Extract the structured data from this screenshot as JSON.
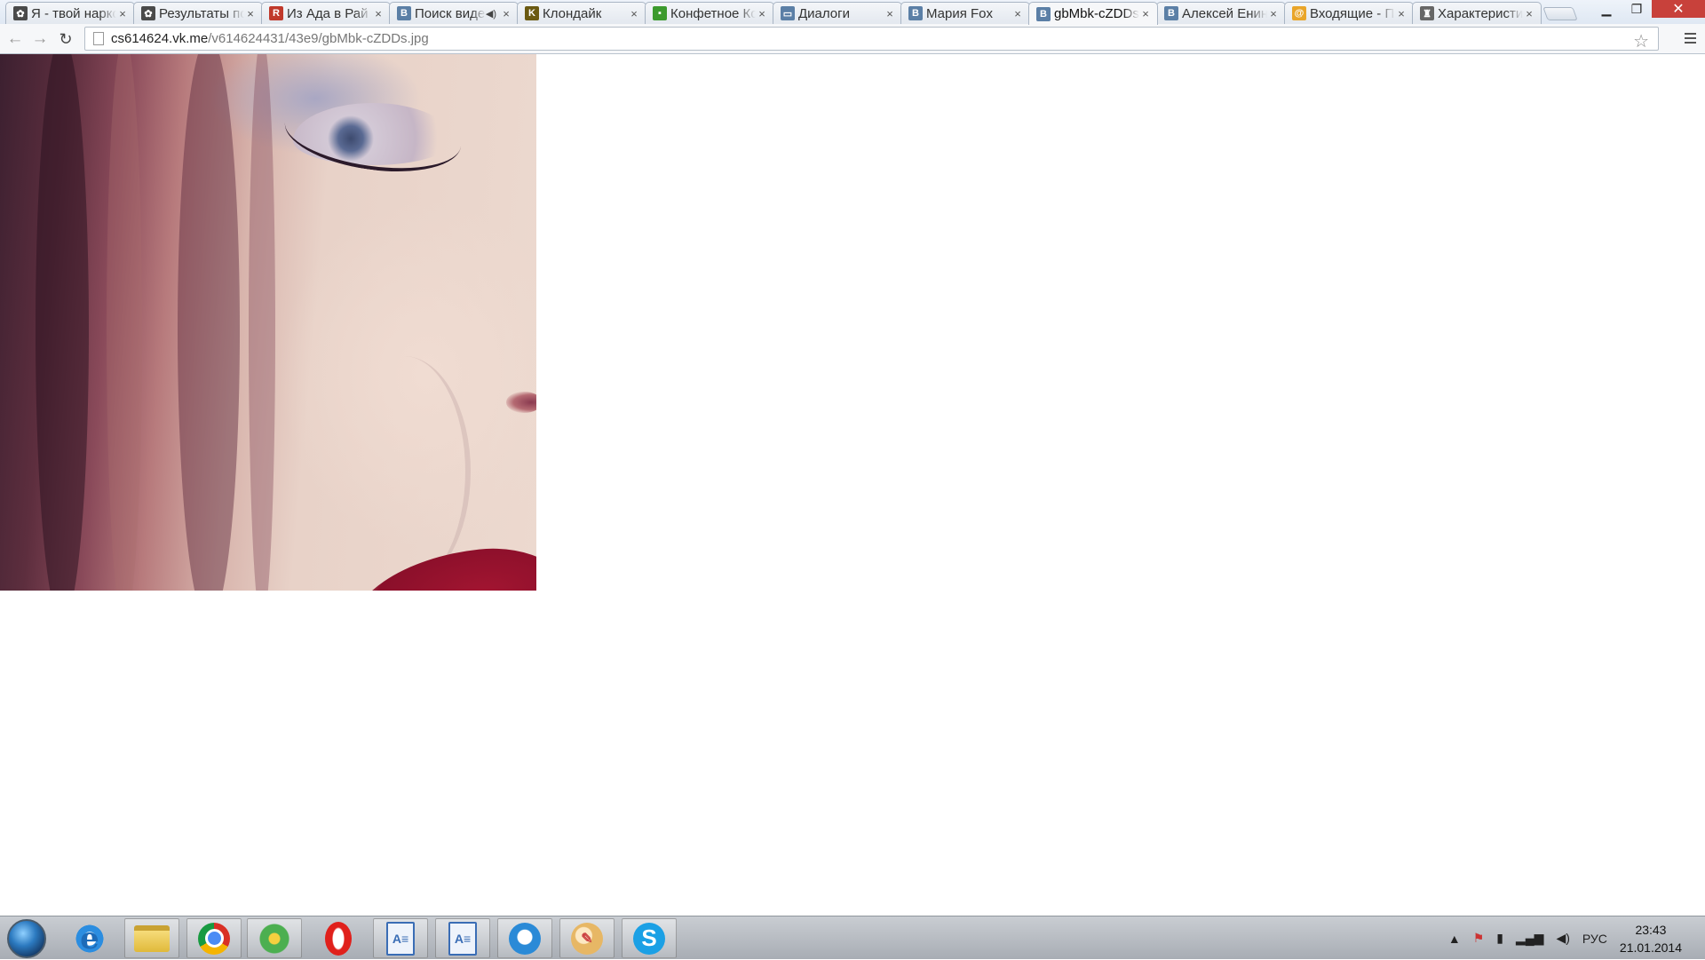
{
  "tabs": [
    {
      "title": "Я - твой наркотик",
      "favicon": "leaf-icon"
    },
    {
      "title": "Результаты поиска",
      "favicon": "leaf-icon"
    },
    {
      "title": "Из Ада в Рай",
      "favicon": "r-icon"
    },
    {
      "title": "Поиск видео",
      "favicon": "vk-icon",
      "audio": true
    },
    {
      "title": "Клондайк",
      "favicon": "k-icon"
    },
    {
      "title": "Конфетное Королевство",
      "favicon": "game-icon"
    },
    {
      "title": "Диалоги",
      "favicon": "chat-icon"
    },
    {
      "title": "Мария Fox",
      "favicon": "vk-icon"
    },
    {
      "title": "gbMbk-cZDDs.jpg",
      "favicon": "vk-icon",
      "active": true
    },
    {
      "title": "Алексей Енин",
      "favicon": "vk-icon"
    },
    {
      "title": "Входящие - Почта",
      "favicon": "mail-icon"
    },
    {
      "title": "Характеристика",
      "favicon": "char-icon"
    }
  ],
  "address": {
    "host": "cs614624.vk.me",
    "path": "/v614624431/43e9/gbMbk-cZDDs.jpg"
  },
  "taskbar": {
    "apps": [
      "internet-explorer",
      "file-explorer",
      "chrome",
      "icq",
      "opera",
      "text-document-1",
      "text-document-2",
      "cloud-app",
      "paint",
      "skype"
    ],
    "language": "РУС",
    "time": "23:43",
    "date": "21.01.2014"
  },
  "colors": {
    "accent_close": "#c8413b",
    "taskbar": "#b4b9bf"
  }
}
